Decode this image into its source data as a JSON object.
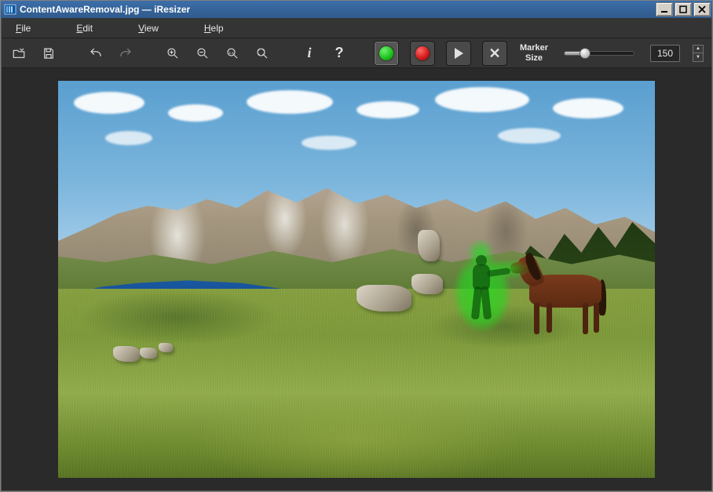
{
  "window": {
    "title": "ContentAwareRemoval.jpg — iResizer"
  },
  "menubar": {
    "file": "File",
    "edit": "Edit",
    "view": "View",
    "help": "Help"
  },
  "toolbar": {
    "open": "Open",
    "save": "Save",
    "undo": "Undo",
    "redo": "Redo",
    "zoom_in": "Zoom In",
    "zoom_out": "Zoom Out",
    "zoom_11": "1:1",
    "zoom_fit": "Fit",
    "info": "Info",
    "help": "Help",
    "marker_green": "Green Marker",
    "marker_red": "Red Marker",
    "run": "Run",
    "clear": "Clear",
    "marker_size_label_line1": "Marker",
    "marker_size_label_line2": "Size",
    "marker_size_value": "150",
    "marker_size_min": 1,
    "marker_size_max": 500,
    "slider_percent": 30
  },
  "canvas": {
    "filename": "ContentAwareRemoval.jpg",
    "active_marker": "green"
  }
}
